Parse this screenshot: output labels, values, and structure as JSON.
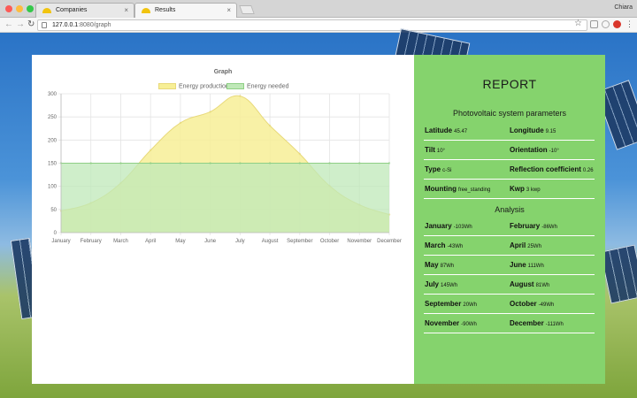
{
  "browser": {
    "tabs": [
      {
        "label": "Companies",
        "active": false
      },
      {
        "label": "Results",
        "active": true
      }
    ],
    "profile": "Chiara",
    "url_host": "127.0.0.1",
    "url_path": ":8080/graph"
  },
  "chart_data": {
    "type": "area",
    "title": "Graph",
    "xlabel": "",
    "ylabel": "",
    "ylim": [
      0,
      300
    ],
    "yticks": [
      0,
      50,
      100,
      150,
      200,
      250,
      300
    ],
    "grid": true,
    "legend_position": "top",
    "categories": [
      "January",
      "February",
      "March",
      "April",
      "May",
      "June",
      "July",
      "August",
      "September",
      "October",
      "November",
      "December"
    ],
    "series": [
      {
        "name": "Energy production",
        "color": "#f7ef96",
        "stroke": "#e8d97a",
        "values": [
          47,
          64,
          107,
          178,
          237,
          261,
          295,
          231,
          170,
          101,
          60,
          39
        ]
      },
      {
        "name": "Energy needed",
        "color": "#bfe8b8",
        "stroke": "#8fcf85",
        "values": [
          150,
          150,
          150,
          150,
          150,
          150,
          150,
          150,
          150,
          150,
          150,
          150
        ]
      }
    ]
  },
  "report": {
    "title": "REPORT",
    "params_title": "Photovoltaic system parameters",
    "params": [
      [
        {
          "label": "Latitude",
          "value": "45.47"
        },
        {
          "label": "Longitude",
          "value": "9.15"
        }
      ],
      [
        {
          "label": "Tilt",
          "value": "10°"
        },
        {
          "label": "Orientation",
          "value": "-10°"
        }
      ],
      [
        {
          "label": "Type",
          "value": "c-Si"
        },
        {
          "label": "Reflection coefficient",
          "value": "0.26"
        }
      ],
      [
        {
          "label": "Mounting",
          "value": "free_standing"
        },
        {
          "label": "Kwp",
          "value": "3 kwp"
        }
      ]
    ],
    "analysis_title": "Analysis",
    "analysis": [
      [
        {
          "label": "January",
          "value": "-103Wh"
        },
        {
          "label": "February",
          "value": "-86Wh"
        }
      ],
      [
        {
          "label": "March",
          "value": "-43Wh"
        },
        {
          "label": "April",
          "value": "25Wh"
        }
      ],
      [
        {
          "label": "May",
          "value": "87Wh"
        },
        {
          "label": "June",
          "value": "111Wh"
        }
      ],
      [
        {
          "label": "July",
          "value": "145Wh"
        },
        {
          "label": "August",
          "value": "81Wh"
        }
      ],
      [
        {
          "label": "September",
          "value": "20Wh"
        },
        {
          "label": "October",
          "value": "-49Wh"
        }
      ],
      [
        {
          "label": "November",
          "value": "-90Wh"
        },
        {
          "label": "December",
          "value": "-111Wh"
        }
      ]
    ]
  }
}
